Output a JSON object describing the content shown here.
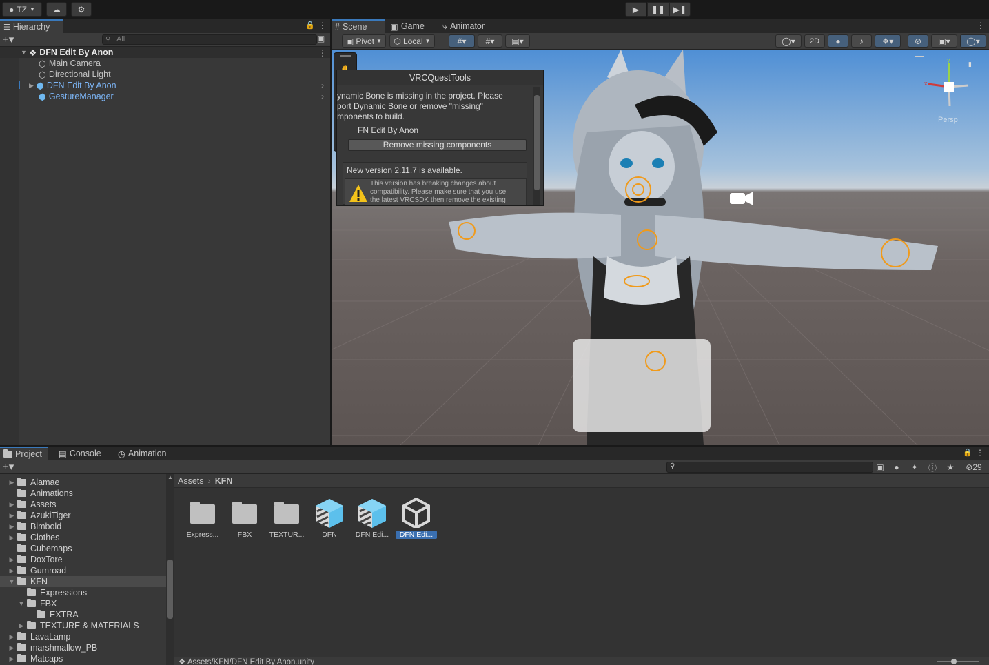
{
  "top_toolbar": {
    "account_label": "TZ",
    "icons": {
      "account": "account-icon",
      "cloud": "cloud-icon",
      "collab": "collab-icon",
      "play": "play-icon",
      "pause": "pause-icon",
      "step": "step-icon"
    }
  },
  "hierarchy": {
    "tab_label": "Hierarchy",
    "search_placeholder": "All",
    "scene_name": "DFN Edit By Anon",
    "items": [
      {
        "label": "Main Camera",
        "prefab": false
      },
      {
        "label": "Directional Light",
        "prefab": false
      },
      {
        "label": "DFN Edit By Anon",
        "prefab": true
      },
      {
        "label": "GestureManager",
        "prefab": true
      }
    ]
  },
  "scene_view": {
    "tabs": [
      {
        "label": "Scene"
      },
      {
        "label": "Game"
      },
      {
        "label": "Animator"
      }
    ],
    "toolbar": {
      "pivot": "Pivot",
      "local": "Local",
      "mode_2d": "2D"
    },
    "persp_label": "Persp"
  },
  "vrcquesttools": {
    "title": "VRCQuestTools",
    "message_lines": [
      "ynamic Bone is missing in the project. Please",
      "port Dynamic Bone or remove \"missing\"",
      "mponents to build."
    ],
    "avatar_name": "FN Edit By Anon",
    "remove_button": "Remove missing components",
    "new_version": "New version 2.11.7 is available.",
    "warning_lines": [
      "This version has breaking changes about",
      "compatibility. Please make sure that you use",
      "the latest VRCSDK then remove the existing"
    ]
  },
  "project": {
    "tabs": [
      {
        "label": "Project"
      },
      {
        "label": "Console"
      },
      {
        "label": "Animation"
      }
    ],
    "hidden_count": "29",
    "tree": [
      {
        "label": "Alamae",
        "indent": 0,
        "expanded": false
      },
      {
        "label": "Animations",
        "indent": 0,
        "expanded": null
      },
      {
        "label": "Assets",
        "indent": 0,
        "expanded": false
      },
      {
        "label": "AzukiTiger",
        "indent": 0,
        "expanded": false
      },
      {
        "label": "Bimbold",
        "indent": 0,
        "expanded": false
      },
      {
        "label": "Clothes",
        "indent": 0,
        "expanded": false
      },
      {
        "label": "Cubemaps",
        "indent": 0,
        "expanded": null
      },
      {
        "label": "DoxTore",
        "indent": 0,
        "expanded": false
      },
      {
        "label": "Gumroad",
        "indent": 0,
        "expanded": false
      },
      {
        "label": "KFN",
        "indent": 0,
        "expanded": true,
        "selected": true
      },
      {
        "label": "Expressions",
        "indent": 1,
        "expanded": null
      },
      {
        "label": "FBX",
        "indent": 1,
        "expanded": true
      },
      {
        "label": "EXTRA",
        "indent": 2,
        "expanded": null
      },
      {
        "label": "TEXTURE & MATERIALS",
        "indent": 1,
        "expanded": false
      },
      {
        "label": "LavaLamp",
        "indent": 0,
        "expanded": false
      },
      {
        "label": "marshmallow_PB",
        "indent": 0,
        "expanded": false
      },
      {
        "label": "Matcaps",
        "indent": 0,
        "expanded": false
      }
    ],
    "breadcrumb": {
      "root": "Assets",
      "current": "KFN"
    },
    "assets": [
      {
        "label": "Express...",
        "kind": "folder"
      },
      {
        "label": "FBX",
        "kind": "folder"
      },
      {
        "label": "TEXTUR...",
        "kind": "folder"
      },
      {
        "label": "DFN",
        "kind": "model"
      },
      {
        "label": "DFN Edi...",
        "kind": "model"
      },
      {
        "label": "DFN Edi...",
        "kind": "scene",
        "selected": true
      }
    ],
    "status_path": "Assets/KFN/DFN Edit By Anon.unity"
  }
}
